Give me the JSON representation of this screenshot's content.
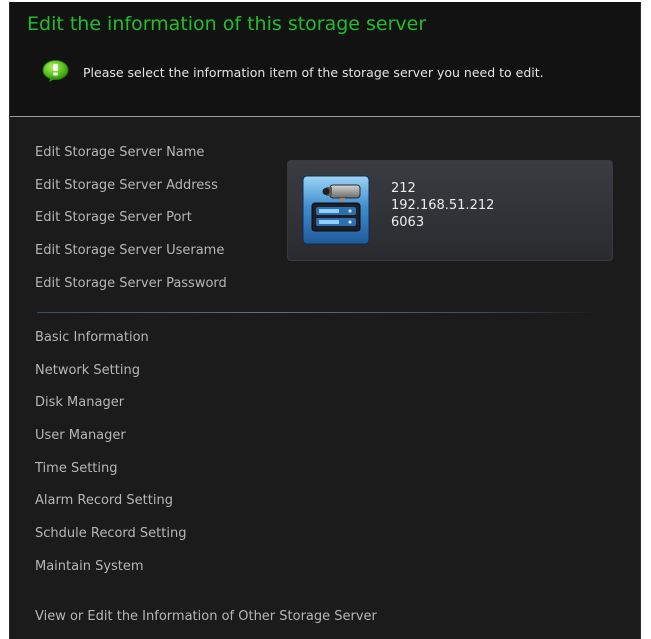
{
  "header": {
    "title": "Edit the information of this storage server",
    "hint": "Please select the information item of the storage server you need to edit."
  },
  "edit_menu": {
    "items": [
      {
        "label": "Edit Storage Server Name"
      },
      {
        "label": "Edit Storage Server Address"
      },
      {
        "label": "Edit Storage Server Port"
      },
      {
        "label": "Edit Storage Server Userame"
      },
      {
        "label": "Edit Storage Server Password"
      }
    ]
  },
  "server_card": {
    "name": "212",
    "address": "192.168.51.212",
    "port": "6063",
    "icon": "storage-server-icon"
  },
  "settings_menu": {
    "items": [
      {
        "label": "Basic Information"
      },
      {
        "label": "Network Setting"
      },
      {
        "label": "Disk Manager"
      },
      {
        "label": "User Manager"
      },
      {
        "label": "Time Setting"
      },
      {
        "label": "Alarm Record Setting"
      },
      {
        "label": "Schdule Record Setting"
      },
      {
        "label": "Maintain System"
      }
    ]
  },
  "footer_link": {
    "label": "View or Edit the Information of Other Storage Server"
  },
  "colors": {
    "title": "#1fbf2a",
    "background": "#1b1b1b",
    "header_background": "#121212",
    "menu_text": "#b6b6b6"
  }
}
